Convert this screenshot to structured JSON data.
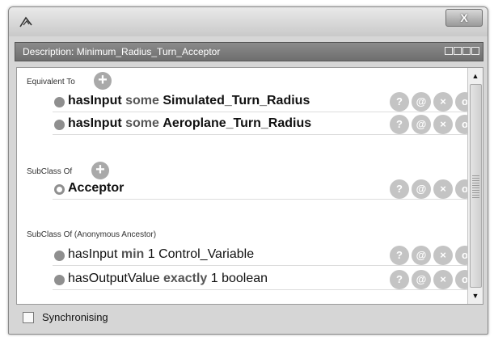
{
  "window": {
    "close_label": "X",
    "view_title": "Description: Minimum_Radius_Turn_Acceptor"
  },
  "add_label": "+",
  "actions": [
    "?",
    "@",
    "×",
    "o"
  ],
  "sections": {
    "equivalent": {
      "label": "Equivalent To",
      "rows": [
        {
          "prop": "hasInput",
          "restriction": "some",
          "value": "Simulated_Turn_Radius"
        },
        {
          "prop": "hasInput",
          "restriction": "some",
          "value": "Aeroplane_Turn_Radius"
        }
      ]
    },
    "subclass": {
      "label": "SubClass Of",
      "rows": [
        {
          "value": "Acceptor"
        }
      ]
    },
    "anonymous": {
      "label": "SubClass Of (Anonymous Ancestor)",
      "rows": [
        {
          "prop": "hasInput",
          "restriction": "min",
          "value": "1 Control_Variable"
        },
        {
          "prop": "hasOutputValue",
          "restriction": "exactly",
          "value": "1 boolean"
        }
      ]
    }
  },
  "scroll": {
    "up": "▲",
    "down": "▼"
  },
  "footer": {
    "sync_label": "Synchronising",
    "sync_checked": false
  },
  "colors": {
    "header_bg": "#7c7c7c",
    "action_button": "#c4c4c4",
    "add_button": "#a9a9a9"
  }
}
